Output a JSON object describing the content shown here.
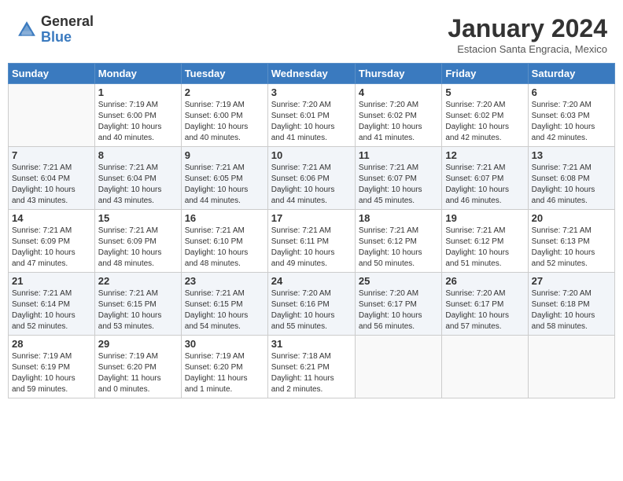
{
  "header": {
    "logo_general": "General",
    "logo_blue": "Blue",
    "month_title": "January 2024",
    "subtitle": "Estacion Santa Engracia, Mexico"
  },
  "days_of_week": [
    "Sunday",
    "Monday",
    "Tuesday",
    "Wednesday",
    "Thursday",
    "Friday",
    "Saturday"
  ],
  "weeks": [
    [
      {
        "day": "",
        "info": ""
      },
      {
        "day": "1",
        "info": "Sunrise: 7:19 AM\nSunset: 6:00 PM\nDaylight: 10 hours\nand 40 minutes."
      },
      {
        "day": "2",
        "info": "Sunrise: 7:19 AM\nSunset: 6:00 PM\nDaylight: 10 hours\nand 40 minutes."
      },
      {
        "day": "3",
        "info": "Sunrise: 7:20 AM\nSunset: 6:01 PM\nDaylight: 10 hours\nand 41 minutes."
      },
      {
        "day": "4",
        "info": "Sunrise: 7:20 AM\nSunset: 6:02 PM\nDaylight: 10 hours\nand 41 minutes."
      },
      {
        "day": "5",
        "info": "Sunrise: 7:20 AM\nSunset: 6:02 PM\nDaylight: 10 hours\nand 42 minutes."
      },
      {
        "day": "6",
        "info": "Sunrise: 7:20 AM\nSunset: 6:03 PM\nDaylight: 10 hours\nand 42 minutes."
      }
    ],
    [
      {
        "day": "7",
        "info": "Sunrise: 7:21 AM\nSunset: 6:04 PM\nDaylight: 10 hours\nand 43 minutes."
      },
      {
        "day": "8",
        "info": "Sunrise: 7:21 AM\nSunset: 6:04 PM\nDaylight: 10 hours\nand 43 minutes."
      },
      {
        "day": "9",
        "info": "Sunrise: 7:21 AM\nSunset: 6:05 PM\nDaylight: 10 hours\nand 44 minutes."
      },
      {
        "day": "10",
        "info": "Sunrise: 7:21 AM\nSunset: 6:06 PM\nDaylight: 10 hours\nand 44 minutes."
      },
      {
        "day": "11",
        "info": "Sunrise: 7:21 AM\nSunset: 6:07 PM\nDaylight: 10 hours\nand 45 minutes."
      },
      {
        "day": "12",
        "info": "Sunrise: 7:21 AM\nSunset: 6:07 PM\nDaylight: 10 hours\nand 46 minutes."
      },
      {
        "day": "13",
        "info": "Sunrise: 7:21 AM\nSunset: 6:08 PM\nDaylight: 10 hours\nand 46 minutes."
      }
    ],
    [
      {
        "day": "14",
        "info": "Sunrise: 7:21 AM\nSunset: 6:09 PM\nDaylight: 10 hours\nand 47 minutes."
      },
      {
        "day": "15",
        "info": "Sunrise: 7:21 AM\nSunset: 6:09 PM\nDaylight: 10 hours\nand 48 minutes."
      },
      {
        "day": "16",
        "info": "Sunrise: 7:21 AM\nSunset: 6:10 PM\nDaylight: 10 hours\nand 48 minutes."
      },
      {
        "day": "17",
        "info": "Sunrise: 7:21 AM\nSunset: 6:11 PM\nDaylight: 10 hours\nand 49 minutes."
      },
      {
        "day": "18",
        "info": "Sunrise: 7:21 AM\nSunset: 6:12 PM\nDaylight: 10 hours\nand 50 minutes."
      },
      {
        "day": "19",
        "info": "Sunrise: 7:21 AM\nSunset: 6:12 PM\nDaylight: 10 hours\nand 51 minutes."
      },
      {
        "day": "20",
        "info": "Sunrise: 7:21 AM\nSunset: 6:13 PM\nDaylight: 10 hours\nand 52 minutes."
      }
    ],
    [
      {
        "day": "21",
        "info": "Sunrise: 7:21 AM\nSunset: 6:14 PM\nDaylight: 10 hours\nand 52 minutes."
      },
      {
        "day": "22",
        "info": "Sunrise: 7:21 AM\nSunset: 6:15 PM\nDaylight: 10 hours\nand 53 minutes."
      },
      {
        "day": "23",
        "info": "Sunrise: 7:21 AM\nSunset: 6:15 PM\nDaylight: 10 hours\nand 54 minutes."
      },
      {
        "day": "24",
        "info": "Sunrise: 7:20 AM\nSunset: 6:16 PM\nDaylight: 10 hours\nand 55 minutes."
      },
      {
        "day": "25",
        "info": "Sunrise: 7:20 AM\nSunset: 6:17 PM\nDaylight: 10 hours\nand 56 minutes."
      },
      {
        "day": "26",
        "info": "Sunrise: 7:20 AM\nSunset: 6:17 PM\nDaylight: 10 hours\nand 57 minutes."
      },
      {
        "day": "27",
        "info": "Sunrise: 7:20 AM\nSunset: 6:18 PM\nDaylight: 10 hours\nand 58 minutes."
      }
    ],
    [
      {
        "day": "28",
        "info": "Sunrise: 7:19 AM\nSunset: 6:19 PM\nDaylight: 10 hours\nand 59 minutes."
      },
      {
        "day": "29",
        "info": "Sunrise: 7:19 AM\nSunset: 6:20 PM\nDaylight: 11 hours\nand 0 minutes."
      },
      {
        "day": "30",
        "info": "Sunrise: 7:19 AM\nSunset: 6:20 PM\nDaylight: 11 hours\nand 1 minute."
      },
      {
        "day": "31",
        "info": "Sunrise: 7:18 AM\nSunset: 6:21 PM\nDaylight: 11 hours\nand 2 minutes."
      },
      {
        "day": "",
        "info": ""
      },
      {
        "day": "",
        "info": ""
      },
      {
        "day": "",
        "info": ""
      }
    ]
  ]
}
